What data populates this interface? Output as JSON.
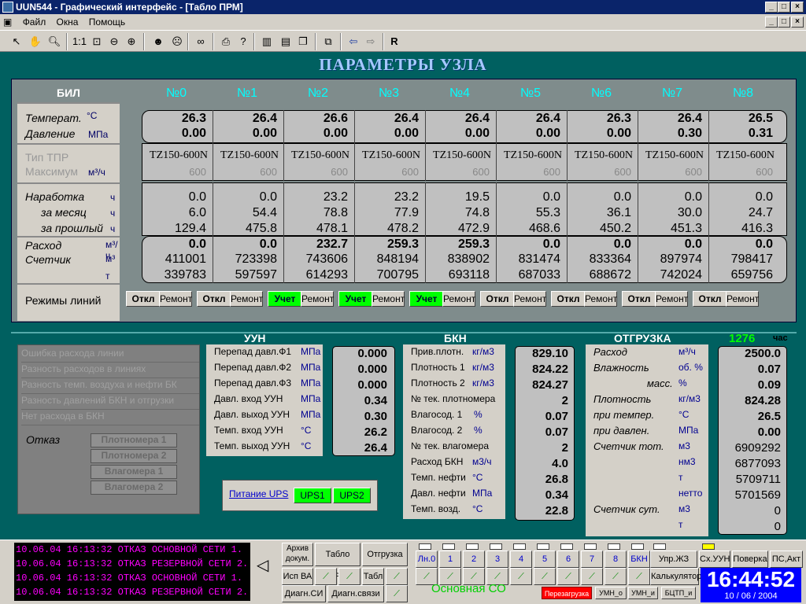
{
  "window": {
    "title": "UUN544 - Графический интерфейс - [Табло ПРМ]"
  },
  "menu": [
    "Файл",
    "Окна",
    "Помощь"
  ],
  "page_title": "ПАРАМЕТРЫ УЗЛА",
  "bil": {
    "title": "БИЛ",
    "temp": "Температ.",
    "temp_u": "°C",
    "pres": "Давление",
    "pres_u": "МПа",
    "tpr": "Тип ТПР",
    "max": "Максимум",
    "max_u": "м³/ч",
    "nar": "Наработка",
    "nar_u": "ч",
    "month": "за месяц",
    "month_u": "ч",
    "prev": "за прошлый",
    "prev_u": "ч",
    "flow": "Расход",
    "flow_u": "м³/ч",
    "cnt": "Счетчик",
    "cnt_u": "м³",
    "t_u": "т",
    "modes": "Режимы линий"
  },
  "lines": [
    {
      "h": "№0",
      "t": "26.3",
      "p": "0.00",
      "tpr": "TZ150-600N",
      "max": "600",
      "n": "0.0",
      "m": "6.0",
      "pr": "129.4",
      "fl": "0.0",
      "c1": "411001",
      "c2": "339783",
      "b1": "Откл",
      "b2": "Ремонт",
      "g": false
    },
    {
      "h": "№1",
      "t": "26.4",
      "p": "0.00",
      "tpr": "TZ150-600N",
      "max": "600",
      "n": "0.0",
      "m": "54.4",
      "pr": "475.8",
      "fl": "0.0",
      "c1": "723398",
      "c2": "597597",
      "b1": "Откл",
      "b2": "Ремонт",
      "g": false
    },
    {
      "h": "№2",
      "t": "26.6",
      "p": "0.00",
      "tpr": "TZ150-600N",
      "max": "600",
      "n": "23.2",
      "m": "78.8",
      "pr": "478.1",
      "fl": "232.7",
      "c1": "743606",
      "c2": "614293",
      "b1": "Учет",
      "b2": "Ремонт",
      "g": true
    },
    {
      "h": "№3",
      "t": "26.4",
      "p": "0.00",
      "tpr": "TZ150-600N",
      "max": "600",
      "n": "23.2",
      "m": "77.9",
      "pr": "478.2",
      "fl": "259.3",
      "c1": "848194",
      "c2": "700795",
      "b1": "Учет",
      "b2": "Ремонт",
      "g": true
    },
    {
      "h": "№4",
      "t": "26.4",
      "p": "0.00",
      "tpr": "TZ150-600N",
      "max": "600",
      "n": "19.5",
      "m": "74.8",
      "pr": "472.9",
      "fl": "259.3",
      "c1": "838902",
      "c2": "693118",
      "b1": "Учет",
      "b2": "Ремонт",
      "g": true
    },
    {
      "h": "№5",
      "t": "26.4",
      "p": "0.00",
      "tpr": "TZ150-600N",
      "max": "600",
      "n": "0.0",
      "m": "55.3",
      "pr": "468.6",
      "fl": "0.0",
      "c1": "831474",
      "c2": "687033",
      "b1": "Откл",
      "b2": "Ремонт",
      "g": false
    },
    {
      "h": "№6",
      "t": "26.3",
      "p": "0.00",
      "tpr": "TZ150-600N",
      "max": "600",
      "n": "0.0",
      "m": "36.1",
      "pr": "450.2",
      "fl": "0.0",
      "c1": "833364",
      "c2": "688672",
      "b1": "Откл",
      "b2": "Ремонт",
      "g": false
    },
    {
      "h": "№7",
      "t": "26.4",
      "p": "0.30",
      "tpr": "TZ150-600N",
      "max": "600",
      "n": "0.0",
      "m": "30.0",
      "pr": "451.3",
      "fl": "0.0",
      "c1": "897974",
      "c2": "742024",
      "b1": "Откл",
      "b2": "Ремонт",
      "g": false
    },
    {
      "h": "№8",
      "t": "26.5",
      "p": "0.31",
      "tpr": "TZ150-600N",
      "max": "600",
      "n": "0.0",
      "m": "24.7",
      "pr": "416.3",
      "fl": "0.0",
      "c1": "798417",
      "c2": "659756",
      "b1": "Откл",
      "b2": "Ремонт",
      "g": false
    }
  ],
  "errors": [
    "Ошибка расхода линии",
    "Разность расходов в линиях",
    "Разность темп. воздуха и нефти БК",
    "Разность давлений БКН и отгрузки",
    "Нет расхода в БКН"
  ],
  "otkaz": {
    "label": "Отказ",
    "items": [
      "Плотномера 1",
      "Плотномера 2",
      "Влагомера 1",
      "Влагомера 2"
    ]
  },
  "uun": {
    "title": "УУН",
    "rows": [
      {
        "l": "Перепад давл.Ф1",
        "u": "МПа",
        "v": "0.000"
      },
      {
        "l": "Перепад давл.Ф2",
        "u": "МПа",
        "v": "0.000"
      },
      {
        "l": "Перепад давл.Ф3",
        "u": "МПа",
        "v": "0.000"
      },
      {
        "l": "Давл. вход УУН",
        "u": "МПа",
        "v": "0.34"
      },
      {
        "l": "Давл. выход УУН",
        "u": "МПа",
        "v": "0.30"
      },
      {
        "l": "Темп. вход УУН",
        "u": "°C",
        "v": "26.2"
      },
      {
        "l": "Темп. выход УУН",
        "u": "°C",
        "v": "26.4"
      }
    ]
  },
  "ups": {
    "label": "Питание UPS",
    "u1": "UPS1",
    "u2": "UPS2"
  },
  "bkn": {
    "title": "БКН",
    "rows": [
      {
        "l": "Прив.плотн.",
        "u": "кг/м3",
        "v": "829.10"
      },
      {
        "l": "Плотность 1",
        "u": "кг/м3",
        "v": "824.22"
      },
      {
        "l": "Плотность 2",
        "u": "кг/м3",
        "v": "824.27"
      },
      {
        "l": "№ тек. плотномера",
        "u": "",
        "v": "2"
      },
      {
        "l": "Влагосод. 1",
        "u": "%",
        "v": "0.07"
      },
      {
        "l": "Влагосод. 2",
        "u": "%",
        "v": "0.07"
      },
      {
        "l": "№ тек. влагомера",
        "u": "",
        "v": "2"
      },
      {
        "l": "Расход БКН",
        "u": "м3/ч",
        "v": "4.0"
      },
      {
        "l": "Темп. нефти",
        "u": "°C",
        "v": "26.8"
      },
      {
        "l": "Давл. нефти",
        "u": "МПа",
        "v": "0.34"
      },
      {
        "l": "Темп. возд.",
        "u": "°C",
        "v": "22.8"
      }
    ]
  },
  "otgr": {
    "title": "ОТГРУЗКА",
    "hours": "1276",
    "hours_u": "час",
    "rows": [
      {
        "l": "Расход",
        "u": "м³/ч",
        "v": "2500.0"
      },
      {
        "l": "Влажность",
        "u": "об. %",
        "v": "0.07"
      },
      {
        "l": "масс.",
        "u": "%",
        "v": "0.09"
      },
      {
        "l": "Плотность",
        "u": "кг/м3",
        "v": "824.28"
      },
      {
        "l": "при темпер.",
        "u": "°C",
        "v": "26.5"
      },
      {
        "l": "при давлен.",
        "u": "МПа",
        "v": "0.00"
      },
      {
        "l": "Счетчик тот.",
        "u": "м3",
        "v": "6909292"
      },
      {
        "l": "",
        "u": "нм3",
        "v": "6877093"
      },
      {
        "l": "",
        "u": "т",
        "v": "5709711"
      },
      {
        "l": "",
        "u": "нетто",
        "v": "5701569"
      },
      {
        "l": "Счетчик сут.",
        "u": "м3",
        "v": "0"
      },
      {
        "l": "",
        "u": "т",
        "v": "0"
      }
    ]
  },
  "log": [
    "10.06.04 16:13:32  ОТКАЗ ОСНОВНОЙ СЕТИ 1.",
    "10.06.04 16:13:32  ОТКАЗ РЕЗЕРВНОЙ СЕТИ 2.",
    "10.06.04 16:13:32  ОТКАЗ ОСНОВНОЙ СЕТИ 1.",
    "10.06.04 16:13:32  ОТКАЗ РЕЗЕРВНОЙ СЕТИ 2."
  ],
  "nav": {
    "arch": "Архив докум.",
    "tablo": "Табло ПРМ",
    "otgr": "Отгрузка",
    "isp": "Исп ВА",
    "tabl": "Табл",
    "diag_si": "Диагн.СИ",
    "diag_sv": "Диагн.связи",
    "ln0": "Лн.0",
    "n1": "1",
    "n2": "2",
    "n3": "3",
    "n4": "4",
    "n5": "5",
    "n6": "6",
    "n7": "7",
    "n8": "8",
    "bkn": "БКН",
    "upr": "Упр.ЖЗ",
    "sxuun": "Сх.УУН",
    "pover": "Поверка",
    "psakt": "ПС,Акт",
    "calc": "Калькулятор",
    "co": "Основная СО",
    "reload": "Перезагрузка",
    "umn_o": "УМН_о",
    "umn_i": "УМН_и",
    "bctp": "БЦТП_и"
  },
  "clock": {
    "time": "16:44:52",
    "date": "10 / 06 / 2004"
  },
  "colors": {
    "bg": "#006060",
    "accent": "#00ffff",
    "green": "#00ff00",
    "alarm": "#ff00ff"
  }
}
